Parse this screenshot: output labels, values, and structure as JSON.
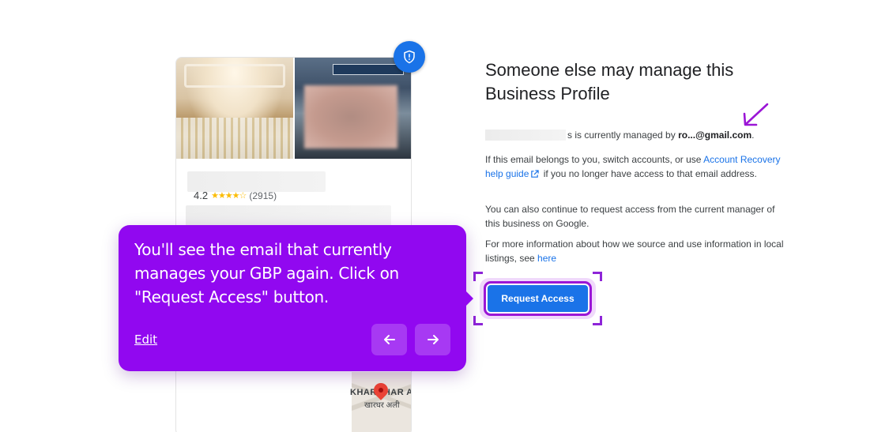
{
  "card": {
    "rating_value": "4.2",
    "stars": "★★★★☆",
    "review_count": "(2915)",
    "map_label_1": "KHARGHAR ALI",
    "map_label_2": "खारघर अली"
  },
  "info": {
    "title": "Someone else may manage this Business Profile",
    "managed_suffix": "s is currently managed by",
    "managed_email": "ro...@gmail.com",
    "managed_period": ".",
    "p1_a": "If this email belongs to you, switch accounts, or use ",
    "p1_link": "Account Recovery help guide",
    "p1_b": " if you no longer have access to that email address.",
    "p2": "You can also continue to request access from the current manager of this business on Google.",
    "p3_a": "For more information about how we source and use information in local listings, see ",
    "p3_link": "here",
    "request_button": "Request Access"
  },
  "tooltip": {
    "text": "You'll see the email that currently manages your GBP again. Click on \"Request Access\" button.",
    "edit_label": "Edit"
  },
  "colors": {
    "accent_purple": "#9108f0",
    "google_blue": "#1a73e8",
    "star_yellow": "#fbbc04"
  }
}
